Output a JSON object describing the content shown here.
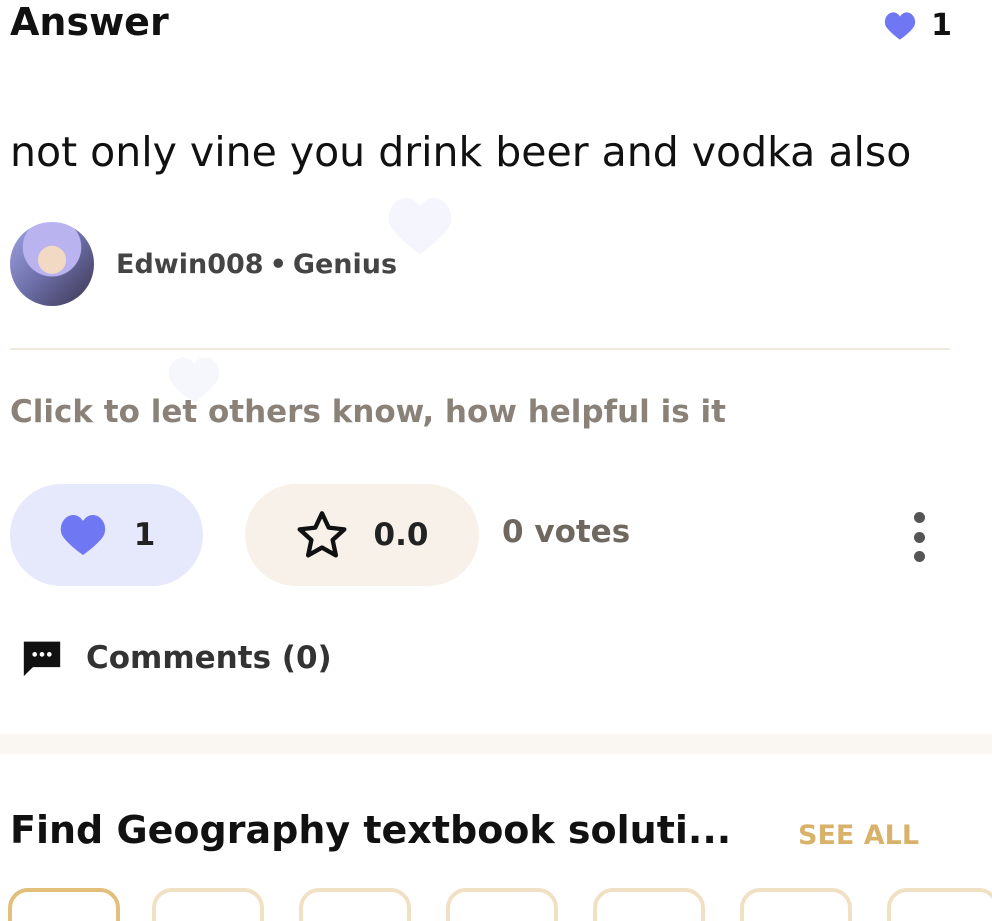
{
  "header": {
    "title": "Answer",
    "like_count": "1"
  },
  "answer": {
    "text": "not only vine you drink beer and vodka also"
  },
  "author": {
    "name": "Edwin008",
    "separator": "•",
    "rank": "Genius"
  },
  "feedback": {
    "prompt": "Click to let others know, how helpful is it",
    "likes": "1",
    "rating": "0.0",
    "votes": "0 votes"
  },
  "comments": {
    "label": "Comments (0)"
  },
  "textbooks": {
    "title": "Find Geography textbook soluti...",
    "see_all": "SEE ALL"
  },
  "colors": {
    "heart": "#6f78f2",
    "see_all": "#d8b26a",
    "like_pill": "#e6e8fb",
    "rating_pill": "#f7f1ea"
  },
  "icons": {
    "like": "heart-icon",
    "rating": "star-icon",
    "more": "more-vertical-icon",
    "comments": "comment-bubble-icon"
  }
}
